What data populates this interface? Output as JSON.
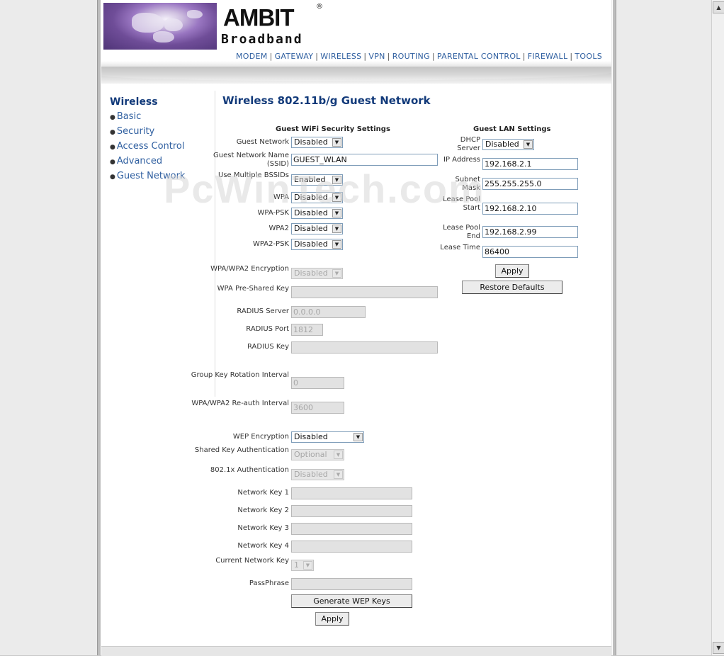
{
  "brand": {
    "name": "AMBIT",
    "reg": "®",
    "sub": "Broadband"
  },
  "topnav": [
    "MODEM",
    "GATEWAY",
    "WIRELESS",
    "VPN",
    "ROUTING",
    "PARENTAL CONTROL",
    "FIREWALL",
    "TOOLS"
  ],
  "sidebar": {
    "title": "Wireless",
    "items": [
      "Basic",
      "Security",
      "Access Control",
      "Advanced",
      "Guest Network"
    ]
  },
  "page_title": "Wireless 802.11b/g Guest Network",
  "watermark": "PcWinTech.com",
  "wifi": {
    "title": "Guest WiFi Security Settings",
    "guest_network": {
      "label": "Guest Network",
      "value": "Disabled"
    },
    "ssid": {
      "label": "Guest Network Name (SSID)",
      "value": "GUEST_WLAN"
    },
    "multi_bssid": {
      "label": "Use Multiple BSSIDs",
      "value": "Enabled"
    },
    "wpa": {
      "label": "WPA",
      "value": "Disabled"
    },
    "wpa_psk": {
      "label": "WPA-PSK",
      "value": "Disabled"
    },
    "wpa2": {
      "label": "WPA2",
      "value": "Disabled"
    },
    "wpa2_psk": {
      "label": "WPA2-PSK",
      "value": "Disabled"
    },
    "encryption": {
      "label": "WPA/WPA2 Encryption",
      "value": "Disabled"
    },
    "psk": {
      "label": "WPA Pre-Shared Key",
      "value": ""
    },
    "radius_server": {
      "label": "RADIUS Server",
      "value": "0.0.0.0"
    },
    "radius_port": {
      "label": "RADIUS Port",
      "value": "1812"
    },
    "radius_key": {
      "label": "RADIUS Key",
      "value": ""
    },
    "group_key": {
      "label": "Group Key Rotation Interval",
      "value": "0"
    },
    "reauth": {
      "label": "WPA/WPA2 Re-auth Interval",
      "value": "3600"
    },
    "wep": {
      "label": "WEP Encryption",
      "value": "Disabled"
    },
    "shared_key_auth": {
      "label": "Shared Key Authentication",
      "value": "Optional"
    },
    "dot1x_auth": {
      "label": "802.1x Authentication",
      "value": "Disabled"
    },
    "key1": {
      "label": "Network Key 1",
      "value": ""
    },
    "key2": {
      "label": "Network Key 2",
      "value": ""
    },
    "key3": {
      "label": "Network Key 3",
      "value": ""
    },
    "key4": {
      "label": "Network Key 4",
      "value": ""
    },
    "current_key": {
      "label": "Current Network Key",
      "value": "1"
    },
    "passphrase": {
      "label": "PassPhrase",
      "value": ""
    },
    "generate_btn": "Generate WEP Keys",
    "apply_btn": "Apply"
  },
  "lan": {
    "title": "Guest LAN Settings",
    "dhcp": {
      "label": "DHCP Server",
      "value": "Disabled"
    },
    "ip": {
      "label": "IP Address",
      "value": "192.168.2.1"
    },
    "mask": {
      "label": "Subnet Mask",
      "value": "255.255.255.0"
    },
    "pool_start": {
      "label": "Lease Pool Start",
      "value": "192.168.2.10"
    },
    "pool_end": {
      "label": "Lease Pool End",
      "value": "192.168.2.99"
    },
    "lease_time": {
      "label": "Lease Time",
      "value": "86400"
    },
    "apply_btn": "Apply",
    "restore_btn": "Restore Defaults"
  }
}
